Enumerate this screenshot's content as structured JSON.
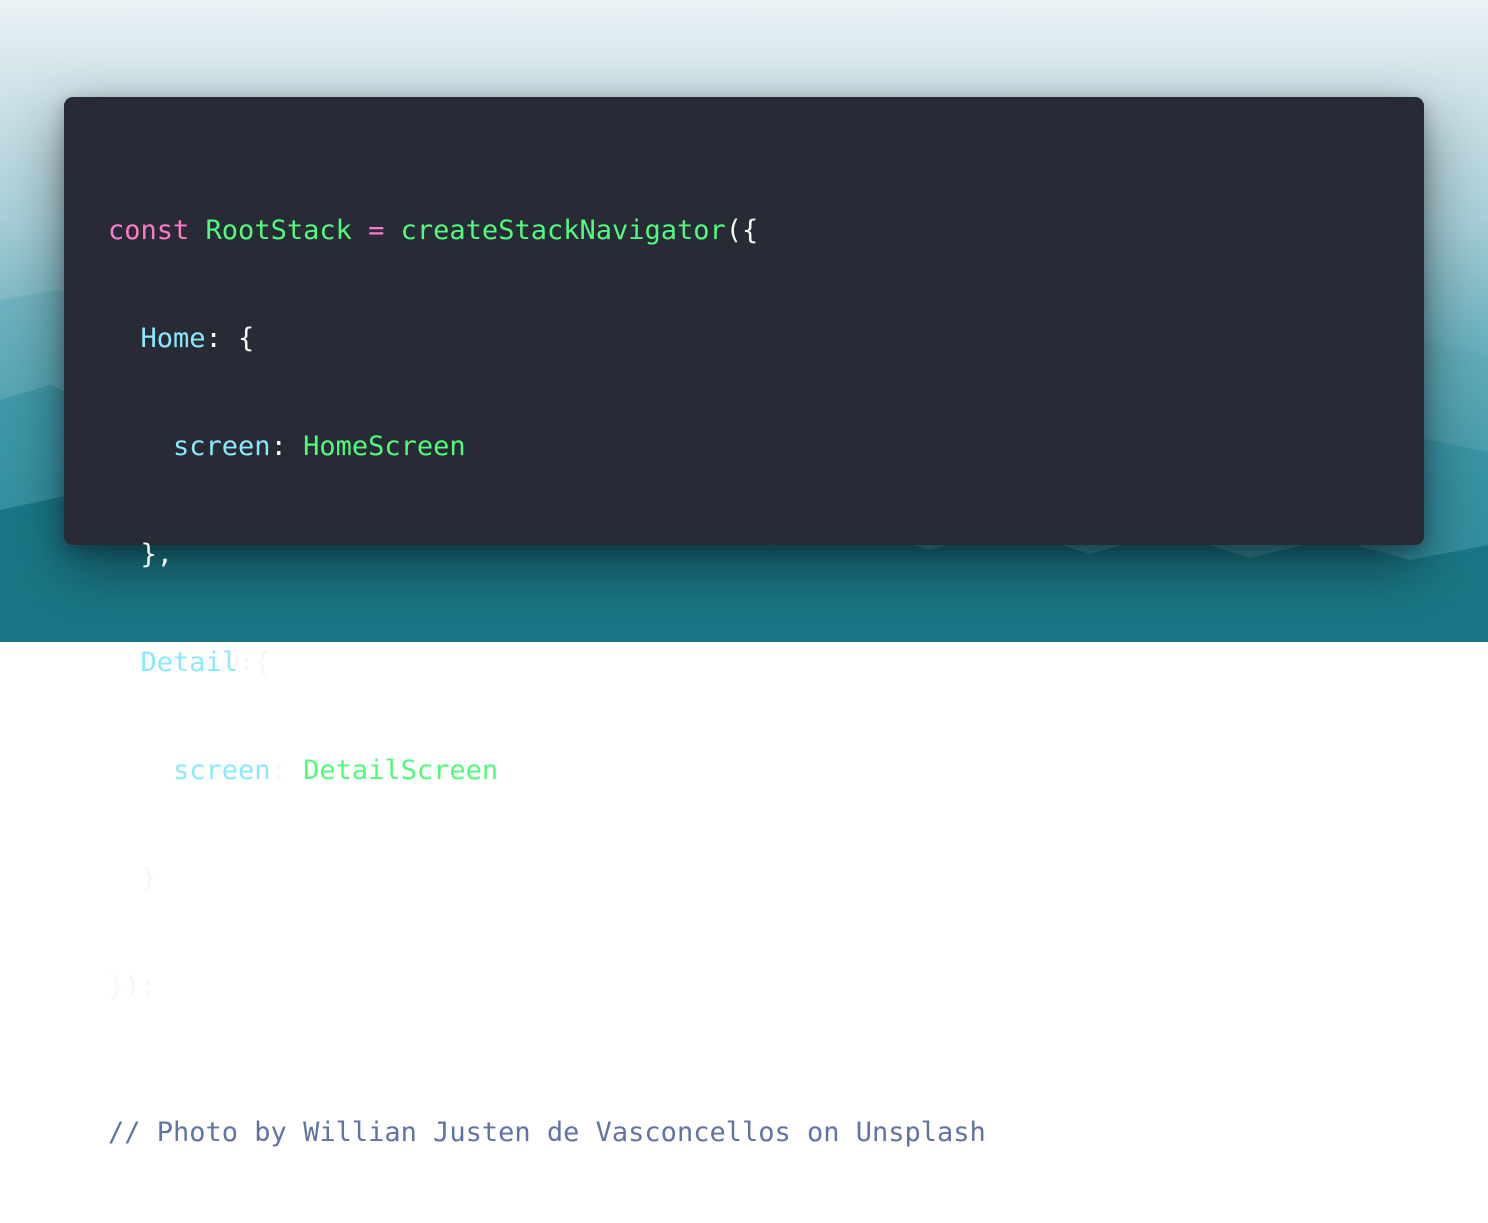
{
  "colors": {
    "window_bg": "#282a36",
    "keyword": "#ff79c6",
    "identifier": "#50fa7b",
    "property": "#8be9fd",
    "punctuation": "#f8f8f2",
    "comment": "#6272a4",
    "background_top": "#eaf2f5",
    "background_bottom": "#0f6573"
  },
  "code": {
    "line1": {
      "keyword": "const",
      "variable": "RootStack",
      "operator": "=",
      "function": "createStackNavigator",
      "open": "({"
    },
    "line2": {
      "property": "Home",
      "rest": ": {"
    },
    "line3": {
      "property": "screen",
      "colon": ": ",
      "value": "HomeScreen"
    },
    "line4": {
      "text": "},"
    },
    "line5": {
      "property": "Detail",
      "rest": ":{"
    },
    "line6": {
      "property": "screen",
      "colon": ": ",
      "value": "DetailScreen"
    },
    "line7": {
      "text": "}"
    },
    "line8": {
      "text": "});"
    },
    "comment": "// Photo by Willian Justen de Vasconcellos on Unsplash"
  }
}
